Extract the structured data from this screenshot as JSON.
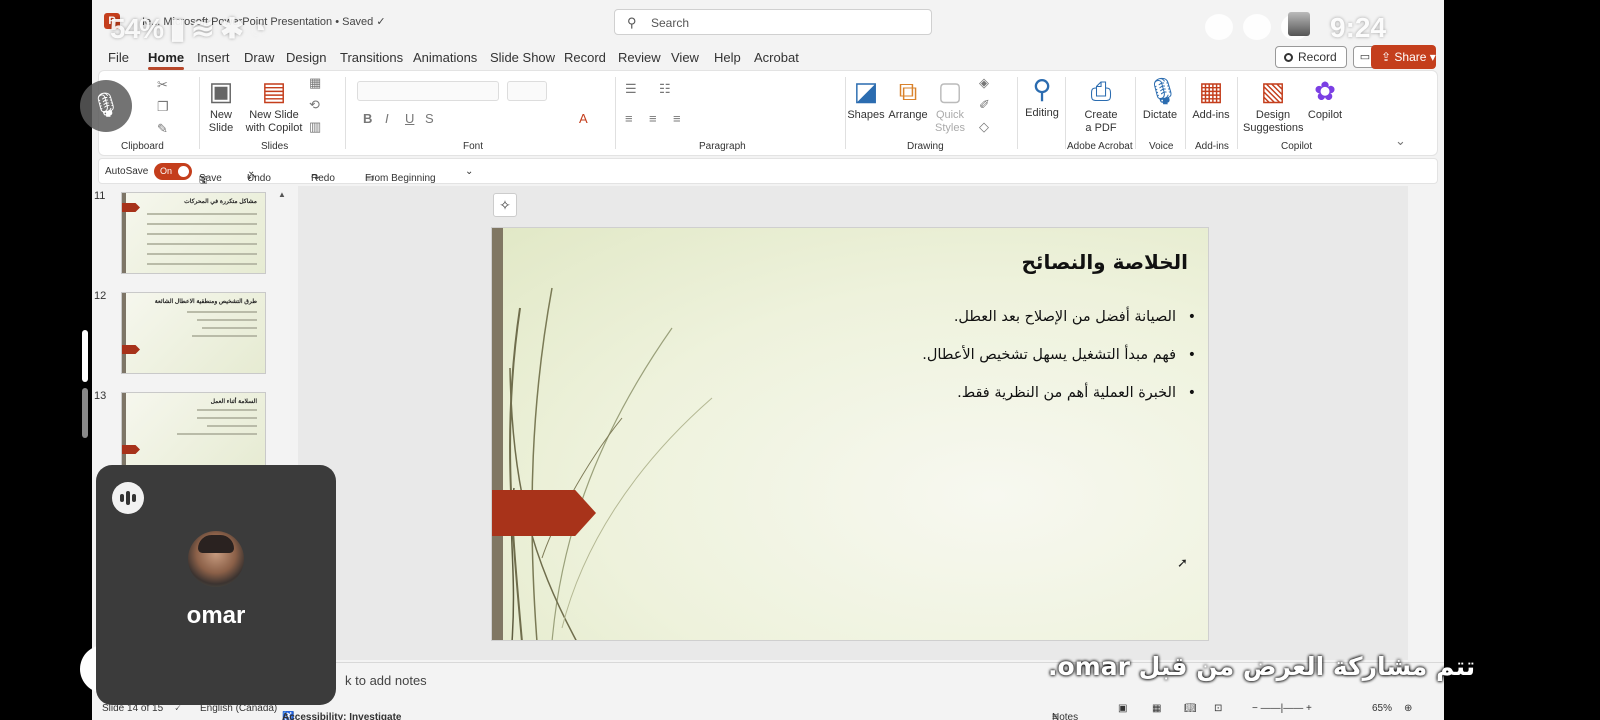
{
  "app": {
    "doc_title": "Ie... Microsoft PowerPoint Presentation • Saved ✓",
    "search_placeholder": "Search"
  },
  "phone_status": {
    "battery": "54%",
    "time": "9:24"
  },
  "menu": {
    "tabs": [
      "File",
      "Home",
      "Insert",
      "Draw",
      "Design",
      "Transitions",
      "Animations",
      "Slide Show",
      "Record",
      "Review",
      "View",
      "Help",
      "Acrobat"
    ],
    "active": "Home",
    "record_label": "Record",
    "share_label": "Share"
  },
  "ribbon": {
    "groups": [
      "Clipboard",
      "Slides",
      "Font",
      "Paragraph",
      "Drawing",
      "Adobe Acrobat",
      "Voice",
      "Add-ins",
      "Copilot"
    ],
    "buttons": {
      "new_slide": "New\nSlide",
      "new_slide_copilot": "New Slide\nwith Copilot",
      "shapes": "Shapes",
      "arrange": "Arrange",
      "quick_styles": "Quick\nStyles",
      "editing": "Editing",
      "create_pdf": "Create\na PDF",
      "dictate": "Dictate",
      "add_ins": "Add-ins",
      "design_suggestions": "Design\nSuggestions",
      "copilot": "Copilot"
    }
  },
  "qat": {
    "autosave": "AutoSave",
    "autosave_state": "On",
    "save": "Save",
    "undo": "Undo",
    "redo": "Redo",
    "from_beginning": "From Beginning"
  },
  "thumbnails": [
    {
      "number": "11",
      "title": "مشاكل متكررة في المحركات"
    },
    {
      "number": "12",
      "title": "طرق التشخيص ومنطقية الاعطال الشائعة"
    },
    {
      "number": "13",
      "title": "السلامة أثناء العمل"
    }
  ],
  "slide": {
    "title": "الخلاصة والنصائح",
    "bullets": [
      "الصيانة أفضل من الإصلاح بعد العطل.",
      "فهم مبدأ التشغيل يسهل تشخيص الأعطال.",
      "الخبرة العملية أهم من النظرية فقط."
    ]
  },
  "notes_placeholder": "k to add notes",
  "statusbar": {
    "slide_info": "Slide 14 of 15",
    "language": "English (Canada)",
    "accessibility": "Accessibility: Investigate",
    "notes": "Notes",
    "zoom": "65%"
  },
  "meeting": {
    "participant_name": "omar",
    "sharing_text": "تتم مشاركة العرض من قبل omar."
  }
}
